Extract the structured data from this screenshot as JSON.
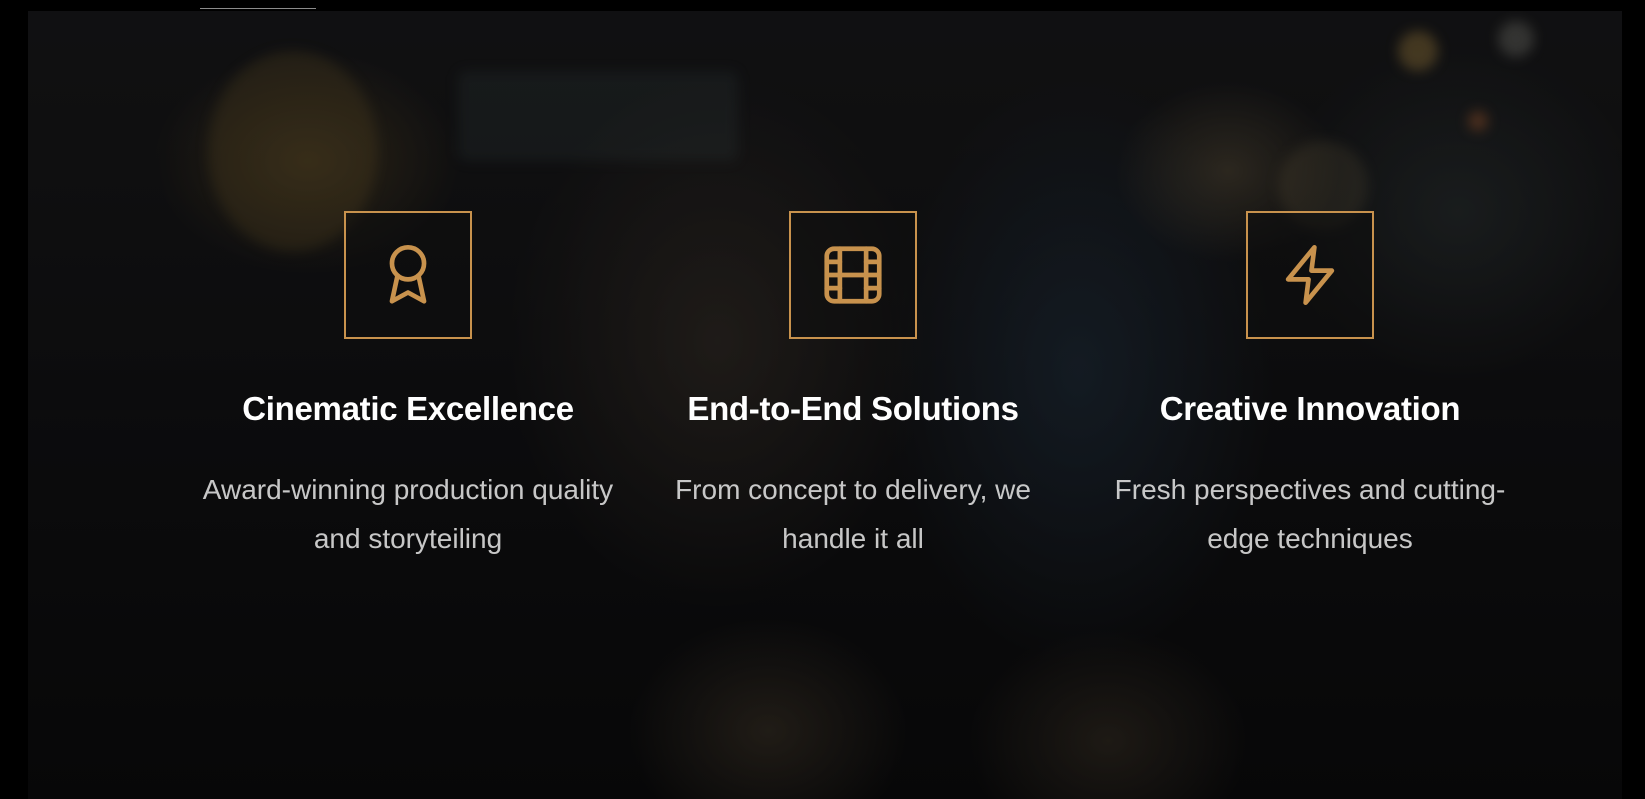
{
  "theme": {
    "accent": "#c8924d",
    "title_color": "#ffffff",
    "text_color": "#e1e1e1",
    "background": "#000000"
  },
  "features": [
    {
      "icon": "award-ribbon-icon",
      "title": "Cinematic Excellence",
      "description": "Award-winning production quality and storyteiling"
    },
    {
      "icon": "film-reel-icon",
      "title": "End-to-End Solutions",
      "description": "From concept to delivery, we handle it all"
    },
    {
      "icon": "lightning-bolt-icon",
      "title": "Creative Innovation",
      "description": "Fresh perspectives and cutting-edge techniques"
    }
  ]
}
